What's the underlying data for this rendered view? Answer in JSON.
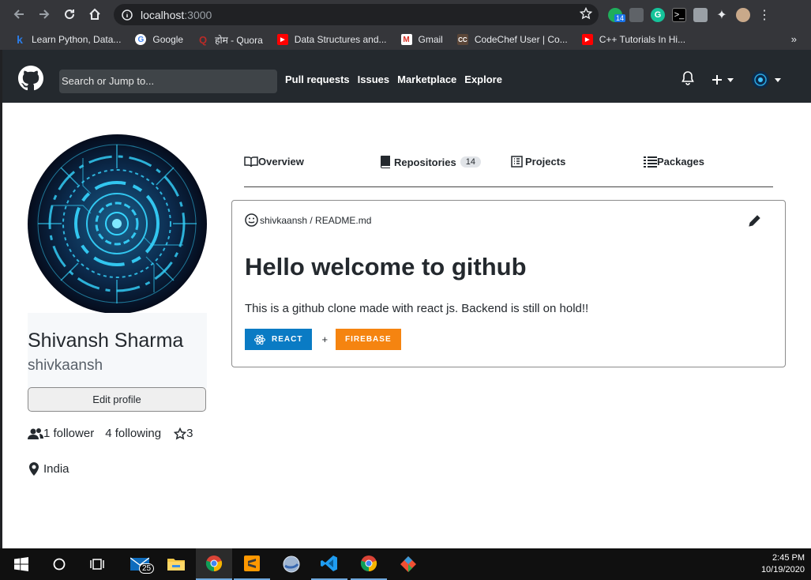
{
  "browser": {
    "url_host": "localhost",
    "url_port": ":3000",
    "extension_badge": "14"
  },
  "bookmarks": [
    {
      "label": "Learn Python, Data...",
      "icon": "k",
      "color": "#2b7de9"
    },
    {
      "label": "Google",
      "icon": "G",
      "color": "#ffffff"
    },
    {
      "label": "होम - Quora",
      "icon": "Q",
      "color": "#b92b27"
    },
    {
      "label": "Data Structures and...",
      "icon": "▶",
      "color": "#ff0000"
    },
    {
      "label": "Gmail",
      "icon": "M",
      "color": "#ffffff"
    },
    {
      "label": "CodeChef User | Co...",
      "icon": "CC",
      "color": "#5b4638"
    },
    {
      "label": "C++ Tutorials In Hi...",
      "icon": "▶",
      "color": "#ff0000"
    }
  ],
  "header": {
    "search_placeholder": "Search or Jump to...",
    "nav": [
      "Pull requests",
      "Issues",
      "Marketplace",
      "Explore"
    ]
  },
  "profile": {
    "full_name": "Shivansh Sharma",
    "username": "shivkaansh",
    "edit_label": "Edit profile",
    "followers": "1 follower",
    "following": "4 following",
    "stars": "3",
    "location": "India"
  },
  "tabs": [
    {
      "label": "Overview"
    },
    {
      "label": "Repositories",
      "count": "14"
    },
    {
      "label": "Projects"
    },
    {
      "label": "Packages"
    }
  ],
  "readme": {
    "path": "shivkaansh / README.md",
    "title": "Hello welcome to github",
    "text": "This is a github clone made with react js. Backend is still on hold!!",
    "badge_react": "REACT",
    "badge_sep": "+",
    "badge_firebase": "FIREBASE",
    "react_color": "#0a7bc4",
    "firebase_color": "#f58410"
  },
  "taskbar": {
    "mail_badge": "25",
    "time": "2:45 PM",
    "date": "10/19/2020"
  }
}
